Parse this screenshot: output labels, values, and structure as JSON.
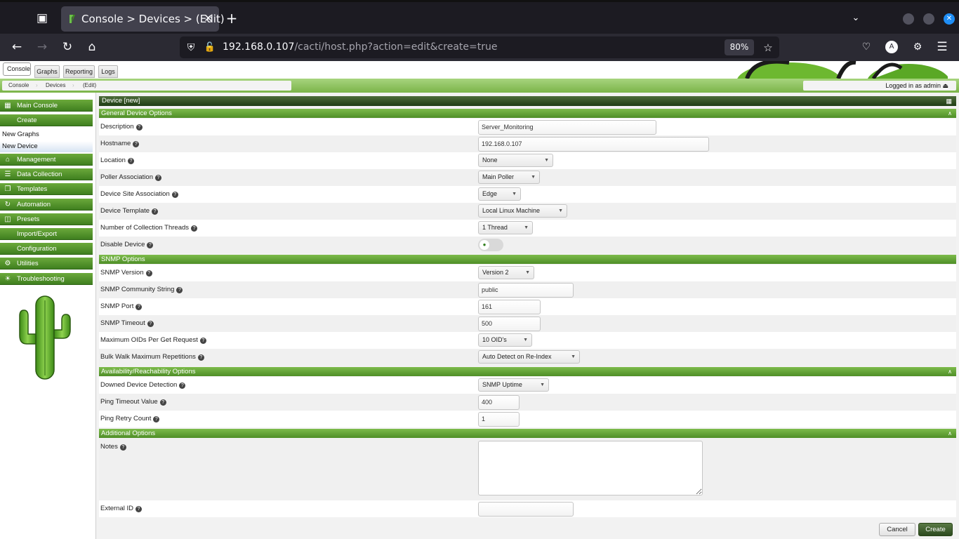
{
  "browser": {
    "tab_title": "Console > Devices > (Edit)",
    "url_host": "192.168.0.107",
    "url_path": "/cacti/host.php?action=edit&create=true",
    "zoom": "80%"
  },
  "top_tabs": [
    "Console",
    "Graphs",
    "Reporting",
    "Logs"
  ],
  "breadcrumbs": [
    "Console",
    "Devices",
    "(Edit)"
  ],
  "login_status": "Logged in as admin",
  "sidebar": {
    "items": [
      {
        "label": "Main Console",
        "icon": "map-icon"
      },
      {
        "label": "Create",
        "icon": ""
      },
      {
        "label": "New Graphs",
        "sub": true
      },
      {
        "label": "New Device",
        "sub": true
      },
      {
        "label": "Management",
        "icon": "home-icon"
      },
      {
        "label": "Data Collection",
        "icon": "database-icon"
      },
      {
        "label": "Templates",
        "icon": "copy-icon"
      },
      {
        "label": "Automation",
        "icon": "refresh-icon"
      },
      {
        "label": "Presets",
        "icon": "layers-icon"
      },
      {
        "label": "Import/Export",
        "icon": ""
      },
      {
        "label": "Configuration",
        "icon": ""
      },
      {
        "label": "Utilities",
        "icon": "gears-icon"
      },
      {
        "label": "Troubleshooting",
        "icon": "bug-icon"
      }
    ]
  },
  "form": {
    "title": "Device [new]",
    "sections": {
      "general": "General Device Options",
      "snmp": "SNMP Options",
      "availability": "Availability/Reachability Options",
      "additional": "Additional Options"
    },
    "fields": {
      "description": {
        "label": "Description",
        "value": "Server_Monitoring"
      },
      "hostname": {
        "label": "Hostname",
        "value": "192.168.0.107"
      },
      "location": {
        "label": "Location",
        "value": "None"
      },
      "poller": {
        "label": "Poller Association",
        "value": "Main Poller"
      },
      "site": {
        "label": "Device Site Association",
        "value": "Edge"
      },
      "template": {
        "label": "Device Template",
        "value": "Local Linux Machine"
      },
      "threads": {
        "label": "Number of Collection Threads",
        "value": "1 Thread"
      },
      "disable": {
        "label": "Disable Device"
      },
      "snmp_version": {
        "label": "SNMP Version",
        "value": "Version 2"
      },
      "community": {
        "label": "SNMP Community String",
        "value": "public"
      },
      "snmp_port": {
        "label": "SNMP Port",
        "value": "161"
      },
      "snmp_timeout": {
        "label": "SNMP Timeout",
        "value": "500"
      },
      "max_oids": {
        "label": "Maximum OIDs Per Get Request",
        "value": "10 OID's"
      },
      "bulk_walk": {
        "label": "Bulk Walk Maximum Repetitions",
        "value": "Auto Detect on Re-Index"
      },
      "downed": {
        "label": "Downed Device Detection",
        "value": "SNMP Uptime"
      },
      "ping_timeout": {
        "label": "Ping Timeout Value",
        "value": "400"
      },
      "ping_retry": {
        "label": "Ping Retry Count",
        "value": "1"
      },
      "notes": {
        "label": "Notes",
        "value": ""
      },
      "external_id": {
        "label": "External ID",
        "value": ""
      }
    },
    "buttons": {
      "cancel": "Cancel",
      "create": "Create"
    }
  }
}
